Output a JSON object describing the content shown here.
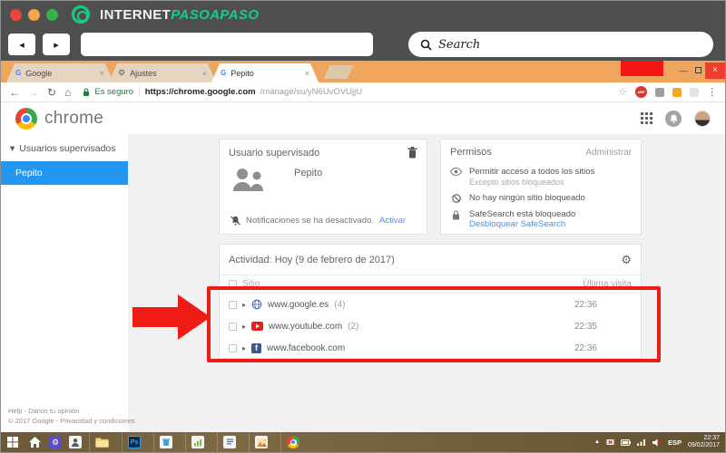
{
  "brand": {
    "wordmark_primary": "INTERNET",
    "wordmark_accent": "PASOAPASO",
    "search_placeholder": "Search"
  },
  "icons": {
    "back": "◂",
    "forward": "▸",
    "close": "×",
    "minimize": "—",
    "nav_back": "←",
    "nav_forward": "→",
    "reload": "↻",
    "home": "⌂",
    "star": "☆",
    "menu": "⋮",
    "gear": "⚙",
    "expand": "▸",
    "collapse": "▾",
    "google_g": "G",
    "facebook_f": "f",
    "tray_caret": "▲"
  },
  "browser": {
    "tabs": [
      {
        "label": "Google"
      },
      {
        "label": "Ajustes"
      },
      {
        "label": "Pepito"
      }
    ],
    "address": {
      "security_label": "Es seguro",
      "url_host": "https://chrome.google.com",
      "url_path": "/manage/su/yN6UvOVUjjU"
    },
    "extensions": {
      "abp_label": "ABP"
    }
  },
  "page": {
    "logo_text": "chrome",
    "sidebar": {
      "group_label": "Usuarios supervisados",
      "selected_item": "Pepito"
    },
    "supervised_card": {
      "title": "Usuario supervisado",
      "name": "Pepito",
      "notification_text": "Notificaciones se ha desactivado.",
      "notification_action": "Activar"
    },
    "permissions_card": {
      "title": "Permisos",
      "action": "Administrar",
      "items": [
        {
          "text": "Permitir acceso a todos los sitios",
          "subtext": "Excepto sitios bloqueados"
        },
        {
          "text": "No hay ningún sitio bloqueado"
        },
        {
          "text": "SafeSearch está bloqueado",
          "link": "Desbloquear SafeSearch"
        }
      ]
    },
    "activity_card": {
      "title": "Actividad: Hoy (9 de febrero de 2017)",
      "site_column": "Sitio",
      "last_visit_column": "Última visita",
      "rows": [
        {
          "site": "www.google.es",
          "count": "(4)",
          "time": "22:36"
        },
        {
          "site": "www.youtube.com",
          "count": "(2)",
          "time": "22:35"
        },
        {
          "site": "www.facebook.com",
          "count": "",
          "time": "22:36"
        }
      ]
    },
    "footer": {
      "line1": "Help - Danos tu opinión",
      "line2": "© 2017 Google - Privacidad y condiciones"
    }
  },
  "taskbar": {
    "photoshop_label": "Ps",
    "language": "ESP",
    "time": "22:37",
    "date": "09/02/2017"
  },
  "colors": {
    "accent_green": "#12cf88",
    "tab_strip_orange": "#efa55b",
    "selection_blue": "#2196f3",
    "link_blue": "#4a90e2",
    "highlight_red": "#ee1c15"
  }
}
